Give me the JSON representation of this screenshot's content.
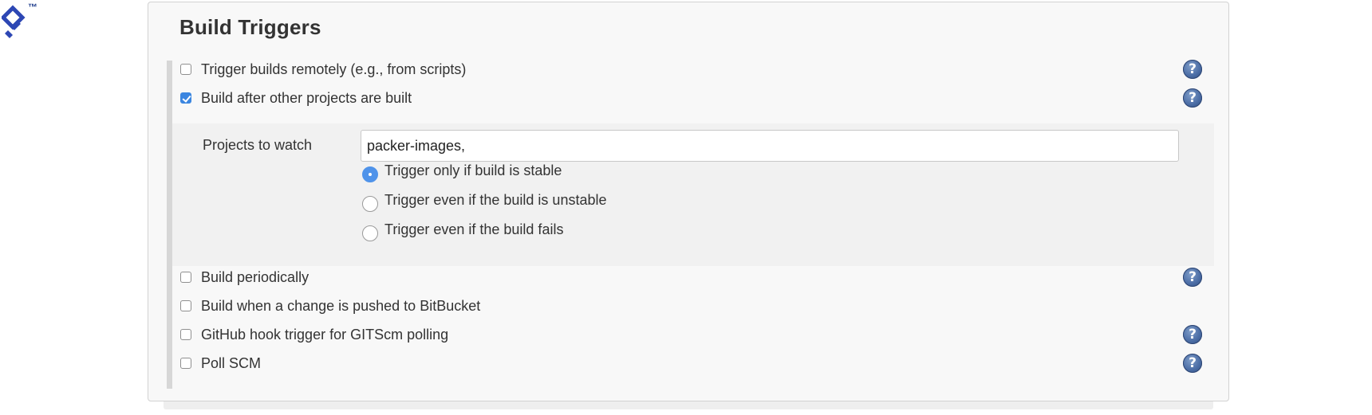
{
  "logo": {
    "name": "toptal-logo",
    "trademark": "™",
    "color": "#1d3b8b"
  },
  "section": {
    "title": "Build Triggers"
  },
  "triggers": [
    {
      "label": "Trigger builds remotely (e.g., from scripts)",
      "checked": false,
      "help": true
    },
    {
      "label": "Build after other projects are built",
      "checked": true,
      "help": true
    },
    {
      "label": "Build periodically",
      "checked": false,
      "help": true
    },
    {
      "label": "Build when a change is pushed to BitBucket",
      "checked": false,
      "help": false
    },
    {
      "label": "GitHub hook trigger for GITScm polling",
      "checked": false,
      "help": true
    },
    {
      "label": "Poll SCM",
      "checked": false,
      "help": true
    }
  ],
  "projects": {
    "label": "Projects to watch",
    "value": "packer-images,"
  },
  "radio_options": [
    {
      "label": "Trigger only if build is stable",
      "selected": true
    },
    {
      "label": "Trigger even if the build is unstable",
      "selected": false
    },
    {
      "label": "Trigger even if the build fails",
      "selected": false
    }
  ],
  "help_icon": {
    "icon": "question-mark-icon",
    "glyph": "?"
  },
  "colors": {
    "accent": "#3b86e0",
    "help_icon": "#4c6ea6",
    "panel_bg": "#f8f8f8"
  }
}
